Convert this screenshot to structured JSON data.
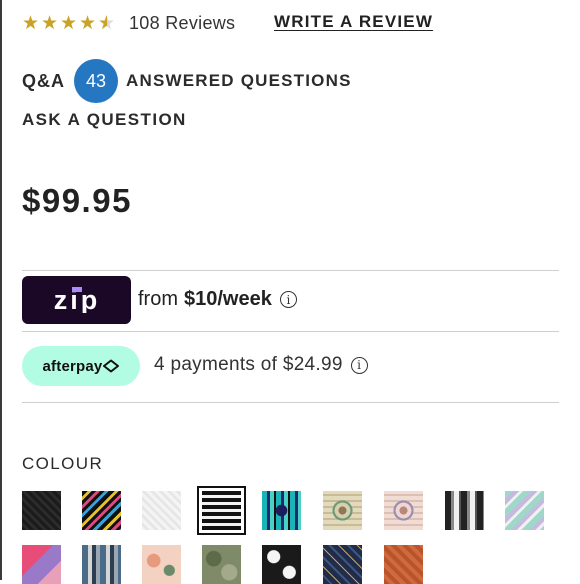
{
  "rating": {
    "value": 4.5,
    "stars_max": 5,
    "review_count_text": "108 Reviews",
    "write_review_label": "WRITE A REVIEW"
  },
  "qa": {
    "label": "Q&A",
    "count": "43",
    "answered_label": "ANSWERED QUESTIONS",
    "ask_label": "ASK A QUESTION"
  },
  "price": "$99.95",
  "zip": {
    "logo_text": "zip",
    "prefix": "from",
    "amount": "$10/week"
  },
  "afterpay": {
    "logo_text": "afterpay",
    "text": "4 payments of $24.99"
  },
  "colour": {
    "label": "COLOUR",
    "selected_index": 3,
    "swatches": [
      "black-woven",
      "rainbow-geometric-black",
      "white-woven",
      "black-white-stripe",
      "teal-tribal",
      "beige-aztec",
      "pink-aztec",
      "black-grey-stripe",
      "mint-lilac-stripe",
      "pink-lilac-diagonal",
      "blue-grey-stripe",
      "peach-floral",
      "sage-camo",
      "black-white-floral",
      "navy-pattern",
      "rust-orange"
    ]
  },
  "colors": {
    "star": "#c9a227",
    "qa_badge": "#2577c2",
    "zip_bg": "#1a0826",
    "zip_accent": "#a98bfa",
    "afterpay_bg": "#b2fce4"
  }
}
